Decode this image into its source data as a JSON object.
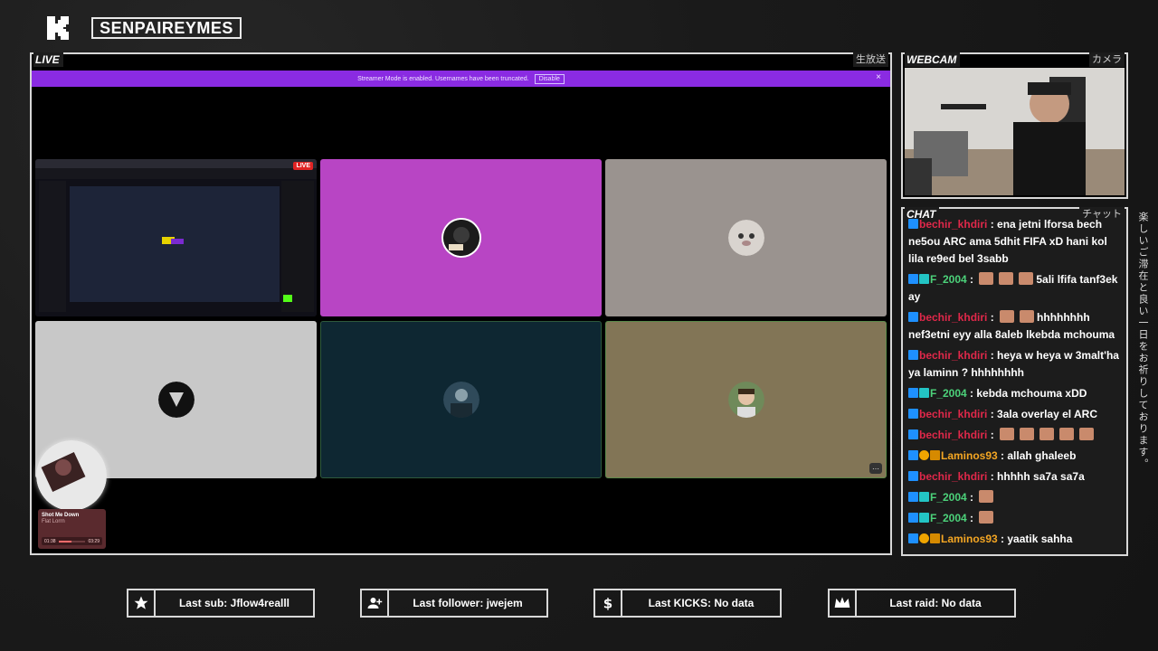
{
  "header": {
    "channel": "SENPAIREYMES"
  },
  "live": {
    "label": "LIVE",
    "jp": "生放送",
    "banner_text": "Streamer Mode is enabled. Usernames have been truncated.",
    "banner_button": "Disable",
    "banner_close": "×",
    "live_badge": "LIVE",
    "more": "⋯",
    "tiles": [
      {
        "color": "#14141f"
      },
      {
        "color": "#b845c4"
      },
      {
        "color": "#9a938f"
      },
      {
        "color": "#c8c8c8"
      },
      {
        "color": "#0e2732"
      },
      {
        "color": "#827556"
      }
    ]
  },
  "music": {
    "title": "Shot Me Down",
    "artist": "Flat Lorrn",
    "elapsed": "01:38",
    "total": "03:29",
    "progress": 0.47
  },
  "webcam": {
    "label": "WEBCAM",
    "jp": "カメラ"
  },
  "chat": {
    "label": "CHAT",
    "jp": "チャット",
    "messages": [
      {
        "user": "bechir_khdiri",
        "color": "red",
        "badges": [
          "blue"
        ],
        "text": "ena jetni lforsa bech ne5ou ARC ama 5dhit FIFA xD hani kol lila re9ed bel 3sabb",
        "emotes": 0
      },
      {
        "user": "F_2004",
        "color": "green",
        "badges": [
          "blue",
          "cyan"
        ],
        "text": "5ali lfifa tanf3ek ay",
        "emotes": 3
      },
      {
        "user": "bechir_khdiri",
        "color": "red",
        "badges": [
          "blue"
        ],
        "text": "hhhhhhhh nef3etni eyy alla 8aleb lkebda mchouma",
        "emotes": 2
      },
      {
        "user": "bechir_khdiri",
        "color": "red",
        "badges": [
          "blue"
        ],
        "text": "heya w heya w 3malt'ha ya laminn ? hhhhhhhh",
        "emotes": 0
      },
      {
        "user": "F_2004",
        "color": "green",
        "badges": [
          "blue",
          "cyan"
        ],
        "text": "kebda mchouma xDD",
        "emotes": 0
      },
      {
        "user": "bechir_khdiri",
        "color": "red",
        "badges": [
          "blue"
        ],
        "text": "3ala overlay el ARC",
        "emotes": 0
      },
      {
        "user": "bechir_khdiri",
        "color": "red",
        "badges": [
          "blue"
        ],
        "text": "",
        "emotes": 5
      },
      {
        "user": "Laminos93",
        "color": "orange",
        "badges": [
          "blue",
          "gold",
          "crown"
        ],
        "text": "allah ghaleeb",
        "emotes": 0
      },
      {
        "user": "bechir_khdiri",
        "color": "red",
        "badges": [
          "blue"
        ],
        "text": "hhhhh sa7a sa7a",
        "emotes": 0
      },
      {
        "user": "F_2004",
        "color": "green",
        "badges": [
          "blue",
          "cyan"
        ],
        "text": "",
        "emotes": 1
      },
      {
        "user": "F_2004",
        "color": "green",
        "badges": [
          "blue",
          "cyan"
        ],
        "text": "",
        "emotes": 1
      },
      {
        "user": "Laminos93",
        "color": "orange",
        "badges": [
          "blue",
          "gold",
          "crown"
        ],
        "text": "yaatik sahha",
        "emotes": 0
      }
    ]
  },
  "side_jp": "楽しいご滞在と良い一日をお祈りしております。",
  "stats": {
    "last_sub": "Last sub: Jflow4realll",
    "last_follower": "Last follower: jwejem",
    "last_kicks": "Last KICKS: No data",
    "last_raid": "Last raid: No data"
  },
  "colors": {
    "accent_purple": "#8a2be2",
    "live_red": "#e02424"
  },
  "icons": [
    "kick-logo-icon",
    "star-icon",
    "add-user-icon",
    "dollar-icon",
    "crown-icon",
    "close-icon",
    "more-icon"
  ]
}
